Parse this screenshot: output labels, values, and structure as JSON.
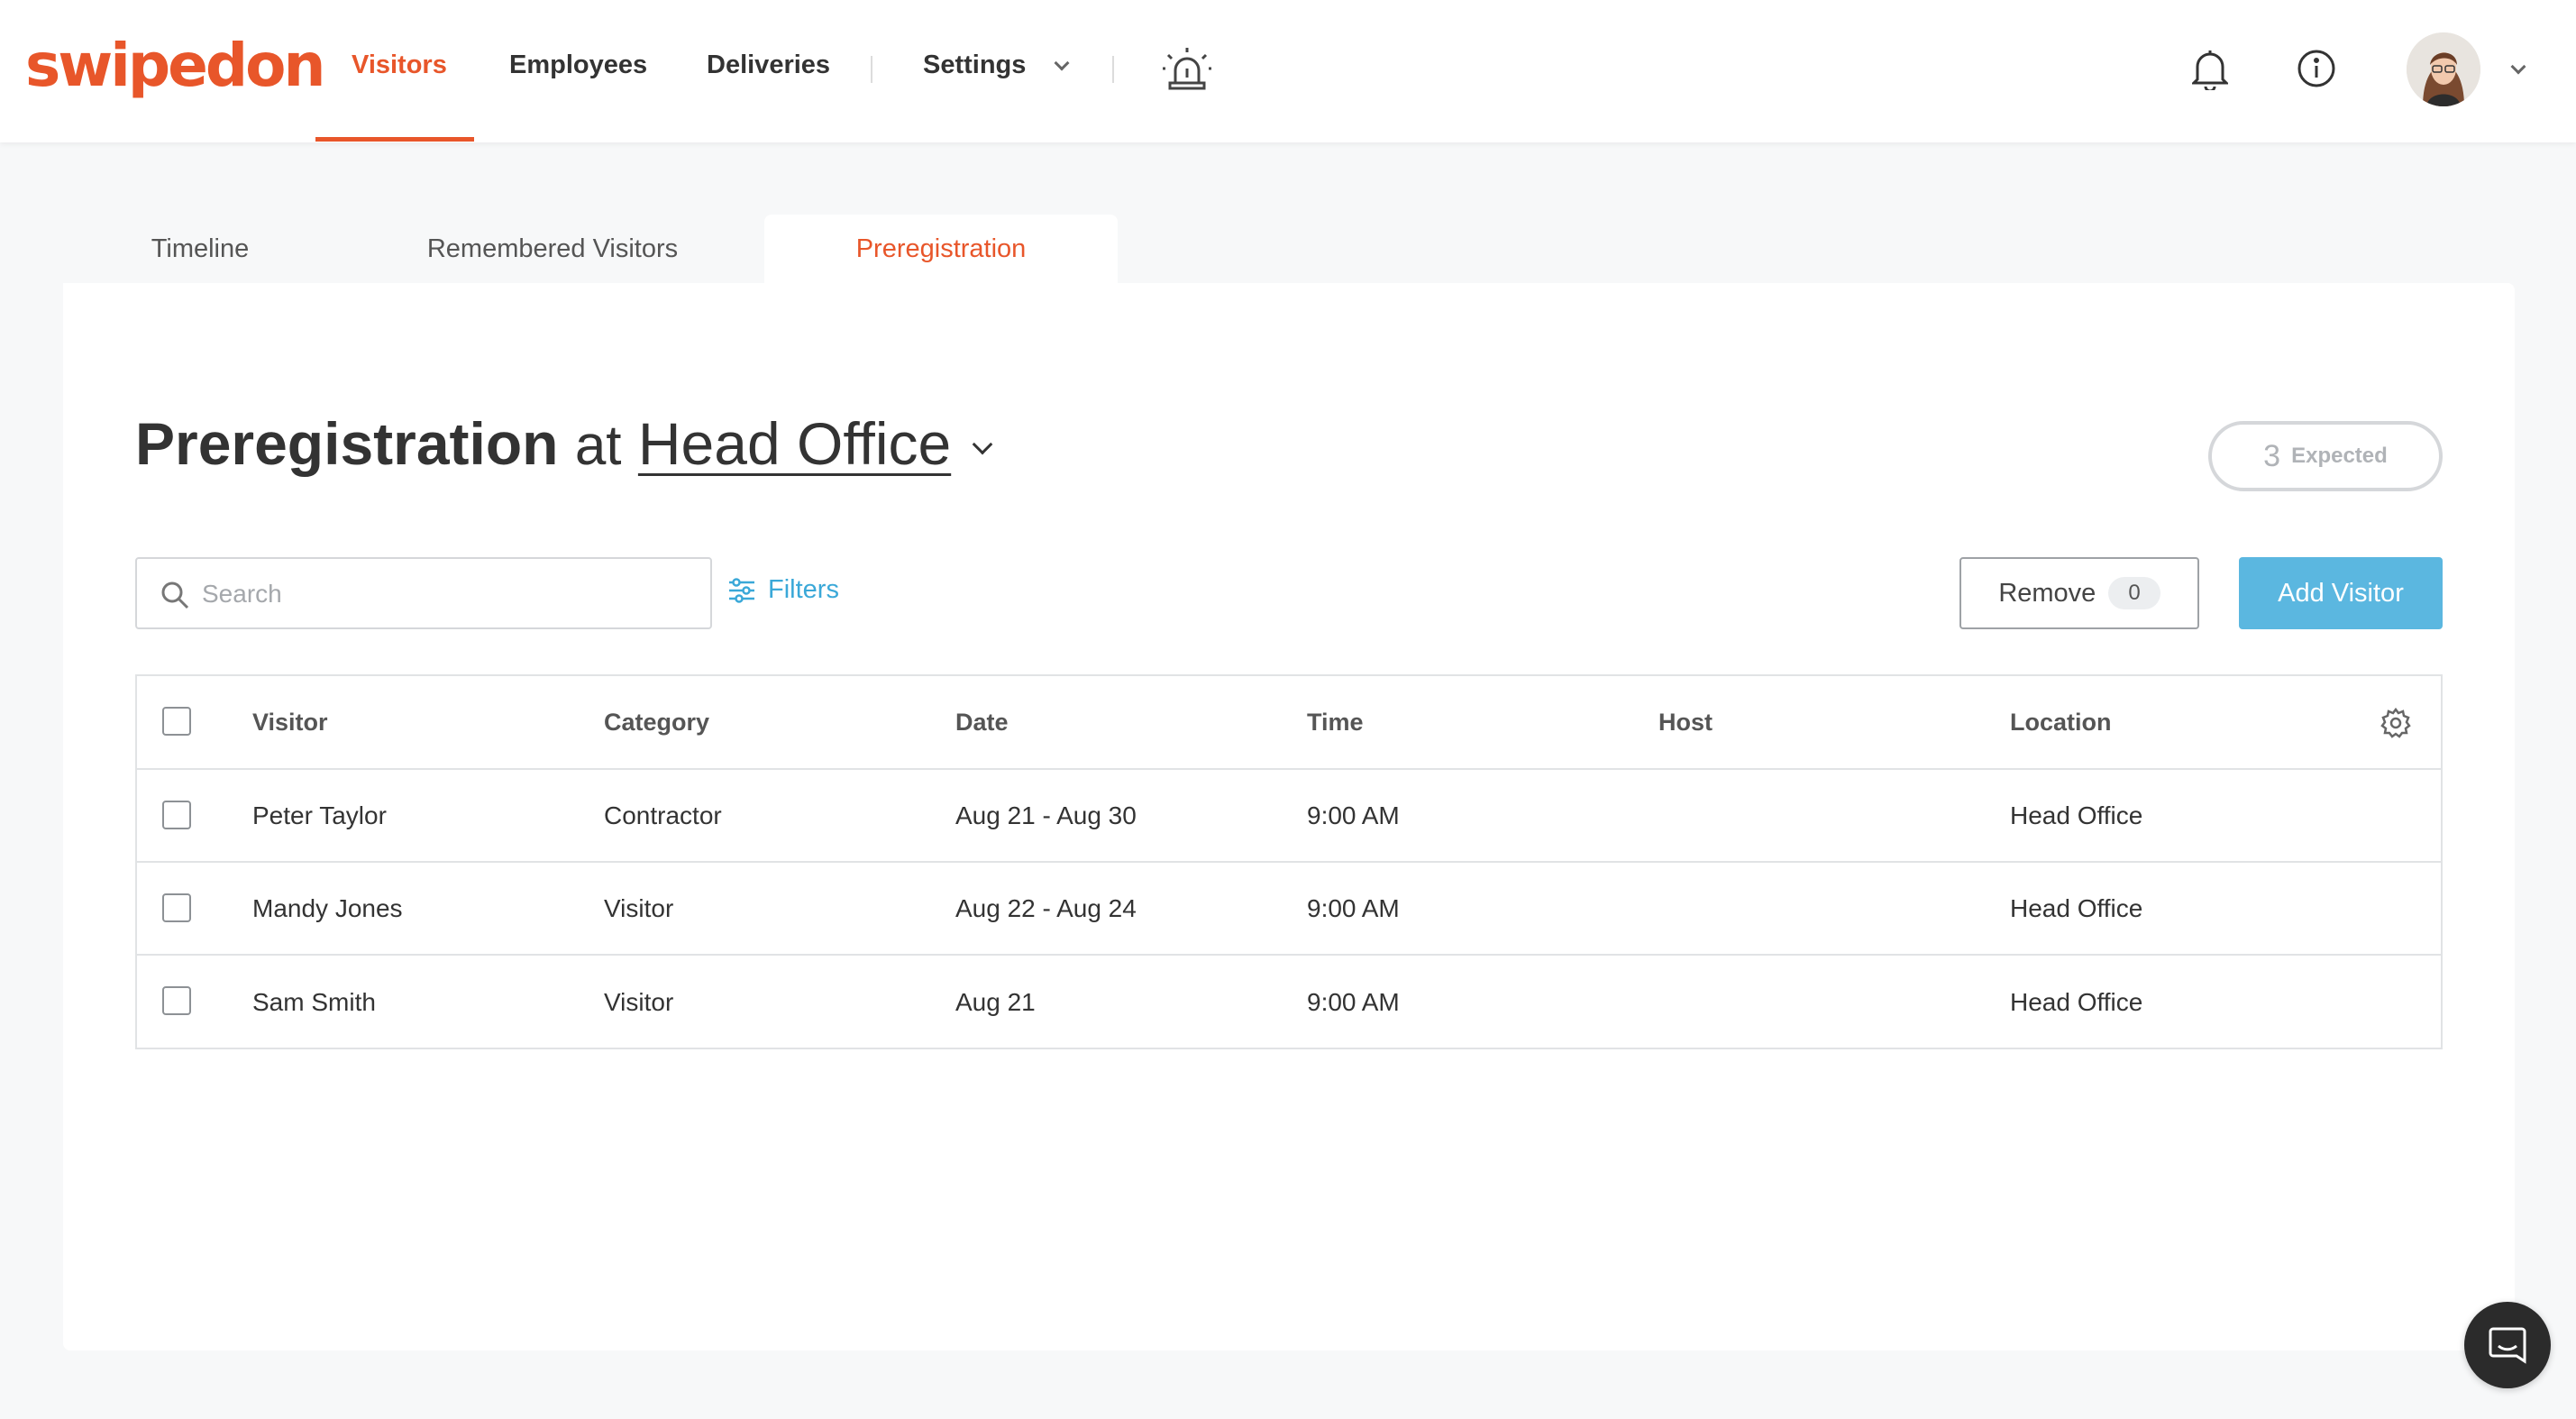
{
  "brand": {
    "name": "swipedon",
    "accent": "#e8562a",
    "link": "#3aa8d8",
    "primary_button": "#5bb7e0"
  },
  "nav": {
    "items": [
      {
        "label": "Visitors",
        "active": true
      },
      {
        "label": "Employees",
        "active": false
      },
      {
        "label": "Deliveries",
        "active": false
      },
      {
        "label": "Settings",
        "active": false
      }
    ],
    "icons": [
      "evacuation-alarm-icon",
      "bell-icon",
      "info-icon",
      "avatar",
      "chevron-down-icon"
    ]
  },
  "tabs": [
    {
      "label": "Timeline",
      "active": false
    },
    {
      "label": "Remembered Visitors",
      "active": false
    },
    {
      "label": "Preregistration",
      "active": true
    }
  ],
  "page": {
    "title": "Preregistration",
    "connector": "at",
    "location": "Head Office",
    "expected_count": "3",
    "expected_label": "Expected"
  },
  "toolbar": {
    "search_placeholder": "Search",
    "search_value": "",
    "filters_label": "Filters",
    "remove_label": "Remove",
    "remove_count": "0",
    "add_label": "Add Visitor"
  },
  "table": {
    "columns": [
      "Visitor",
      "Category",
      "Date",
      "Time",
      "Host",
      "Location"
    ],
    "rows": [
      {
        "visitor": "Peter Taylor",
        "category": "Contractor",
        "date": "Aug 21 - Aug 30",
        "time": "9:00 AM",
        "host": "",
        "location": "Head Office"
      },
      {
        "visitor": "Mandy Jones",
        "category": "Visitor",
        "date": "Aug 22 - Aug 24",
        "time": "9:00 AM",
        "host": "",
        "location": "Head Office"
      },
      {
        "visitor": "Sam Smith",
        "category": "Visitor",
        "date": "Aug 21",
        "time": "9:00 AM",
        "host": "",
        "location": "Head Office"
      }
    ]
  }
}
